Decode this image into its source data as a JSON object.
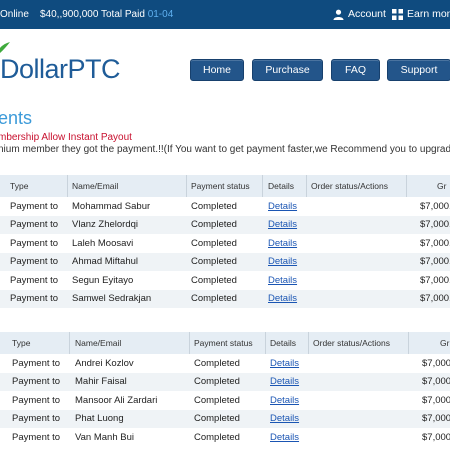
{
  "topbar": {
    "online": "Online",
    "total_paid": "$40,,900,000 Total Paid",
    "date": "01-04",
    "account": "Account",
    "earn": "Earn mone"
  },
  "logo": {
    "text": "DollarPTC"
  },
  "nav": [
    "Home",
    "Purchase",
    "FAQ",
    "Support"
  ],
  "page": {
    "title": "ents",
    "notice_red": "mbership Allow Instant Payout",
    "notice_black": "nium member they got the payment.!!(If You want to get payment faster,we Recommend you to upgrad"
  },
  "columns": [
    "Type",
    "Name/Email",
    "Payment status",
    "Details",
    "Order status/Actions",
    "Gr"
  ],
  "table1": [
    {
      "type": "Payment to",
      "name": "Mohammad Sabur",
      "status": "Completed",
      "details": "Details",
      "gross": "$7,000."
    },
    {
      "type": "Payment to",
      "name": "Vlanz Zhelordqi",
      "status": "Completed",
      "details": "Details",
      "gross": "$7,000."
    },
    {
      "type": "Payment to",
      "name": "Laleh Moosavi",
      "status": "Completed",
      "details": "Details",
      "gross": "$7,000."
    },
    {
      "type": "Payment to",
      "name": "Ahmad Miftahul",
      "status": "Completed",
      "details": "Details",
      "gross": "$7,000."
    },
    {
      "type": "Payment to",
      "name": "Segun Eyitayo",
      "status": "Completed",
      "details": "Details",
      "gross": "$7,000."
    },
    {
      "type": "Payment to",
      "name": "Samwel Sedrakjan",
      "status": "Completed",
      "details": "Details",
      "gross": "$7,000."
    }
  ],
  "table2": [
    {
      "type": "Payment to",
      "name": "Andrei Kozlov",
      "status": "Completed",
      "details": "Details",
      "gross": "$7,000"
    },
    {
      "type": "Payment to",
      "name": "Mahir Faisal",
      "status": "Completed",
      "details": "Details",
      "gross": "$7,000"
    },
    {
      "type": "Payment to",
      "name": "Mansoor Ali Zardari",
      "status": "Completed",
      "details": "Details",
      "gross": "$7,000"
    },
    {
      "type": "Payment to",
      "name": "Phat Luong",
      "status": "Completed",
      "details": "Details",
      "gross": "$7,000"
    },
    {
      "type": "Payment to",
      "name": "Van Manh Bui",
      "status": "Completed",
      "details": "Details",
      "gross": "$7,000"
    }
  ],
  "colors": {
    "topbar": "#0f4b7f",
    "nav": "#23558a",
    "title": "#3b9ad9",
    "notice": "#c8102e",
    "link": "#1a55b3"
  }
}
